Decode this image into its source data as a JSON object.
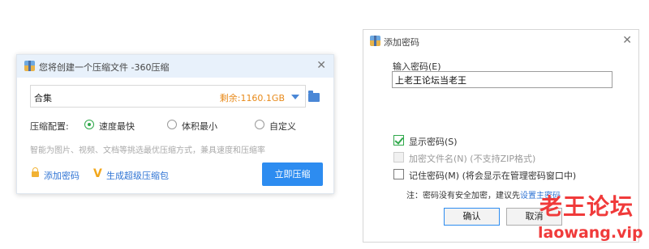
{
  "compress_dialog": {
    "title": "您将创建一个压缩文件 -360压缩",
    "close_icon": "close-icon",
    "path_value": "合集",
    "free_space": "剩余:1160.1GB",
    "config_label": "压缩配置:",
    "options": [
      {
        "label": "速度最快",
        "selected": true
      },
      {
        "label": "体积最小",
        "selected": false
      },
      {
        "label": "自定义",
        "selected": false
      }
    ],
    "hint": "智能为图片、视频、文档等挑选最优压缩方式，兼具速度和压缩率",
    "add_password": "添加密码",
    "super_pack": "生成超级压缩包",
    "compress_button": "立即压缩",
    "accent_color": "#2d8cf0"
  },
  "password_dialog": {
    "title": "添加密码",
    "input_label": "输入密码(E)",
    "input_value": "上老王论坛当老王",
    "show_password": {
      "label": "显示密码(S)",
      "checked": true
    },
    "encrypt_filenames": {
      "label": "加密文件名(N) (不支持ZIP格式)",
      "checked": false,
      "disabled": true
    },
    "remember_password": {
      "label": "记住密码(M) (将会显示在管理密码窗口中)",
      "checked": false
    },
    "note_text": "注：密码没有安全加密，建议先",
    "note_link": "设置主密码",
    "ok_button": "确认",
    "cancel_button": "取消"
  },
  "watermark": {
    "line1": "老王论坛",
    "line2": "laowang.vip",
    "color": "#f03a3a"
  }
}
